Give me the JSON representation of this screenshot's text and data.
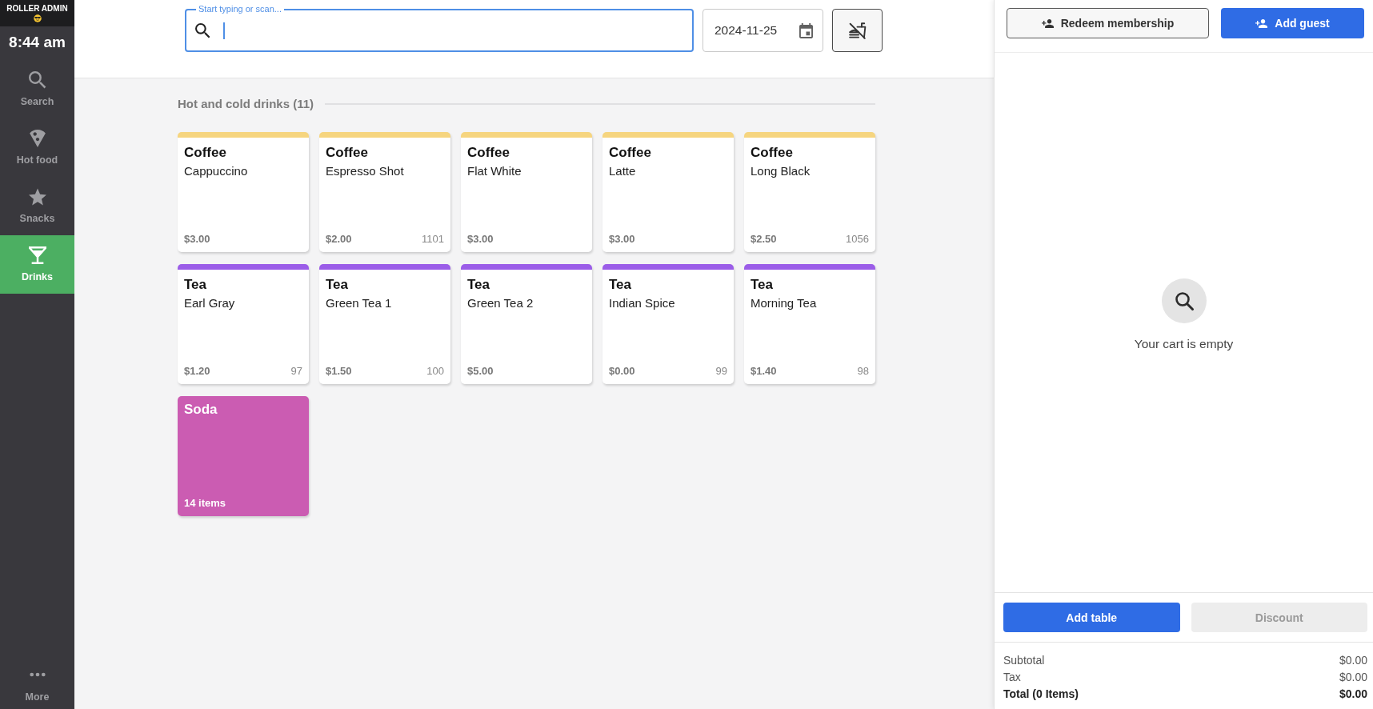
{
  "sidebar": {
    "brand": "ROLLER ADMIN",
    "time": "8:44 am",
    "items": [
      {
        "kind": "search",
        "label": "Search",
        "selected": false
      },
      {
        "kind": "food",
        "label": "Hot food",
        "selected": false
      },
      {
        "kind": "snack",
        "label": "Snacks",
        "selected": false
      },
      {
        "kind": "drink",
        "label": "Drinks",
        "selected": true
      }
    ],
    "more": {
      "label": "More"
    }
  },
  "search": {
    "label": "Start typing or scan..."
  },
  "date_field": {
    "value": "2024-11-25"
  },
  "section": {
    "title": "Hot and cold drinks (11)"
  },
  "products": [
    {
      "kind": "product",
      "category": "Coffee",
      "name": "Cappuccino",
      "price": "$3.00",
      "color": "#f6d57f"
    },
    {
      "kind": "product",
      "category": "Coffee",
      "name": "Espresso Shot",
      "price": "$2.00",
      "count": "1101",
      "color": "#f6d57f"
    },
    {
      "kind": "product",
      "category": "Coffee",
      "name": "Flat White",
      "price": "$3.00",
      "color": "#f6d57f"
    },
    {
      "kind": "product",
      "category": "Coffee",
      "name": "Latte",
      "price": "$3.00",
      "color": "#f6d57f"
    },
    {
      "kind": "product",
      "category": "Coffee",
      "name": "Long Black",
      "price": "$2.50",
      "count": "1056",
      "color": "#f6d57f"
    },
    {
      "kind": "product",
      "category": "Tea",
      "name": "Earl Gray",
      "price": "$1.20",
      "count": "97",
      "color": "#9b5de8"
    },
    {
      "kind": "product",
      "category": "Tea",
      "name": "Green Tea 1",
      "price": "$1.50",
      "count": "100",
      "color": "#9b5de8"
    },
    {
      "kind": "product",
      "category": "Tea",
      "name": "Green Tea 2",
      "price": "$5.00",
      "color": "#9b5de8"
    },
    {
      "kind": "product",
      "category": "Tea",
      "name": "Indian Spice",
      "price": "$0.00",
      "count": "99",
      "color": "#9b5de8"
    },
    {
      "kind": "product",
      "category": "Tea",
      "name": "Morning Tea",
      "price": "$1.40",
      "count": "98",
      "color": "#9b5de8"
    },
    {
      "kind": "group",
      "name": "Soda",
      "count": "14 items",
      "color": "#cb5cb2"
    }
  ],
  "cart": {
    "buttons": [
      {
        "kind": "outline",
        "label": "Redeem membership"
      },
      {
        "kind": "primary",
        "label": "Add guest"
      }
    ],
    "empty_message": "Your cart is empty",
    "actions": [
      {
        "label": "Add table",
        "disabled": false
      },
      {
        "label": "Discount",
        "disabled": true
      }
    ],
    "totals": [
      {
        "kind": "line",
        "label": "Subtotal",
        "value": "$0.00"
      },
      {
        "kind": "line",
        "label": "Tax",
        "value": "$0.00"
      },
      {
        "kind": "total",
        "label": "Total (0 Items)",
        "value": "$0.00"
      }
    ]
  }
}
